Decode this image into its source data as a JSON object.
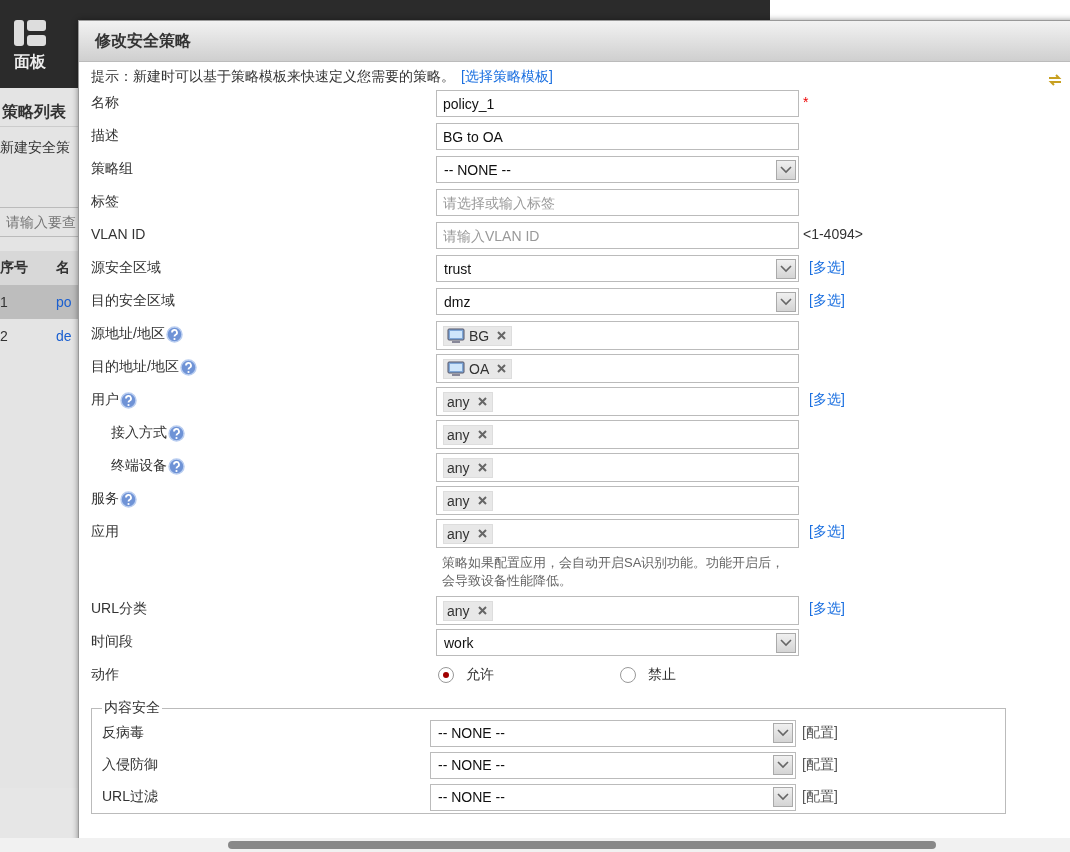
{
  "background": {
    "panel_label": "面板",
    "list_title": "策略列表",
    "new_link": "新建安全策",
    "search_placeholder": "请输入要查",
    "columns": [
      "序号",
      "名"
    ],
    "rows": [
      {
        "cells": [
          "1",
          "po"
        ],
        "selected": true
      },
      {
        "cells": [
          "2",
          "de"
        ],
        "selected": false
      }
    ]
  },
  "dialog": {
    "title": "修改安全策略",
    "hint": {
      "text": "提示：新建时可以基于策略模板来快速定义您需要的策略。",
      "link": "[选择策略模板]"
    },
    "fields": [
      {
        "kind": "text",
        "label": "名称",
        "value": "policy_1",
        "required_mark": "*"
      },
      {
        "kind": "text",
        "label": "描述",
        "value": "BG to OA"
      },
      {
        "kind": "select",
        "label": "策略组",
        "value": "-- NONE --"
      },
      {
        "kind": "text",
        "label": "标签",
        "placeholder": "请选择或输入标签"
      },
      {
        "kind": "text",
        "label": "VLAN ID",
        "placeholder": "请输入VLAN ID",
        "suffix": "<1-4094>"
      },
      {
        "kind": "select",
        "label": "源安全区域",
        "value": "trust",
        "link": "[多选]"
      },
      {
        "kind": "select",
        "label": "目的安全区域",
        "value": "dmz",
        "link": "[多选]"
      },
      {
        "kind": "tags",
        "label": "源地址/地区",
        "help": true,
        "tags": [
          {
            "text": "BG",
            "host": true
          }
        ]
      },
      {
        "kind": "tags",
        "label": "目的地址/地区",
        "help": true,
        "tags": [
          {
            "text": "OA",
            "host": true
          }
        ]
      },
      {
        "kind": "tags",
        "label": "用户",
        "help": true,
        "link": "[多选]",
        "tags": [
          {
            "text": "any",
            "host": false
          }
        ],
        "children": [
          {
            "kind": "tags",
            "label": "接入方式",
            "help": true,
            "tags": [
              {
                "text": "any",
                "host": false
              }
            ]
          },
          {
            "kind": "tags",
            "label": "终端设备",
            "help": true,
            "tags": [
              {
                "text": "any",
                "host": false
              }
            ]
          }
        ]
      },
      {
        "kind": "tags",
        "label": "服务",
        "help": true,
        "tags": [
          {
            "text": "any",
            "host": false
          }
        ]
      },
      {
        "kind": "tags",
        "label": "应用",
        "link": "[多选]",
        "tags": [
          {
            "text": "any",
            "host": false
          }
        ],
        "note": "策略如果配置应用，会自动开启SA识别功能。功能开启后，会导致设备性能降低。"
      },
      {
        "kind": "tags",
        "label": "URL分类",
        "link": "[多选]",
        "tags": [
          {
            "text": "any",
            "host": false
          }
        ]
      },
      {
        "kind": "select",
        "label": "时间段",
        "value": "work"
      },
      {
        "kind": "radio",
        "label": "动作",
        "options": [
          {
            "text": "允许",
            "selected": true
          },
          {
            "text": "禁止",
            "selected": false
          }
        ]
      }
    ],
    "content_security": {
      "legend": "内容安全",
      "rows": [
        {
          "label": "反病毒",
          "value": "-- NONE --",
          "link": "[配置]"
        },
        {
          "label": "入侵防御",
          "value": "-- NONE --",
          "link": "[配置]"
        },
        {
          "label": "URL过滤",
          "value": "-- NONE --",
          "link": "[配置]"
        }
      ]
    }
  }
}
